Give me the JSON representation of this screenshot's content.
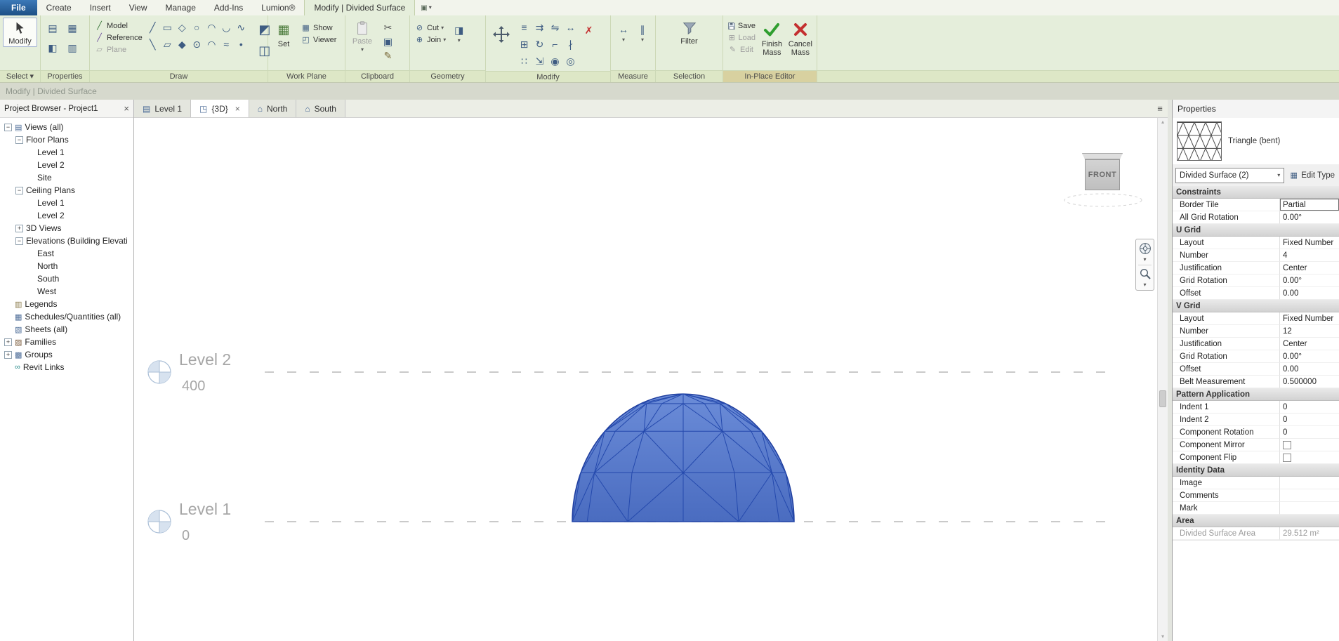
{
  "ribbon": {
    "tabs": [
      {
        "label": "File",
        "type": "file"
      },
      {
        "label": "Create"
      },
      {
        "label": "Insert"
      },
      {
        "label": "View"
      },
      {
        "label": "Manage"
      },
      {
        "label": "Add-Ins"
      },
      {
        "label": "Lumion®"
      },
      {
        "label": "Modify | Divided Surface",
        "active": true
      }
    ],
    "select": {
      "modify_label": "Modify",
      "panel_label": "Select ▾"
    },
    "properties_panel": {
      "panel_label": "Properties",
      "tools": [
        {
          "name": "properties-palette-icon",
          "glyph": "▤"
        },
        {
          "name": "family-types-icon",
          "glyph": "▦"
        },
        {
          "name": "family-category-icon",
          "glyph": "◧"
        },
        {
          "name": "visibility-icon",
          "glyph": "▥"
        }
      ]
    },
    "draw": {
      "panel_label": "Draw",
      "model_label": "Model",
      "reference_label": "Reference",
      "plane_label": "Plane",
      "model_icon": "╱",
      "reference_icon": "╱",
      "plane_icon": "▱",
      "tools": [
        {
          "name": "line-icon",
          "glyph": "╱"
        },
        {
          "name": "rectangle-icon",
          "glyph": "▭"
        },
        {
          "name": "polygon-icon",
          "glyph": "◇"
        },
        {
          "name": "circle-icon",
          "glyph": "○"
        },
        {
          "name": "start-end-arc-icon",
          "glyph": "◠"
        },
        {
          "name": "center-arc-icon",
          "glyph": "◡"
        },
        {
          "name": "spline-icon",
          "glyph": "∿"
        },
        {
          "name": "pick-lines-icon",
          "glyph": "╲"
        },
        {
          "name": "rotated-rectangle-icon",
          "glyph": "▱"
        },
        {
          "name": "inscribed-polygon-icon",
          "glyph": "◆"
        },
        {
          "name": "ellipse-icon",
          "glyph": "⊙"
        },
        {
          "name": "fillet-arc-icon",
          "glyph": "◠"
        },
        {
          "name": "tangent-arc-icon",
          "glyph": "≈"
        },
        {
          "name": "point-element-icon",
          "glyph": "•"
        }
      ],
      "extra_tools": [
        {
          "name": "set-surface-icon",
          "glyph": "◩"
        },
        {
          "name": "divide-surface-icon",
          "glyph": "◫"
        }
      ]
    },
    "work_plane": {
      "panel_label": "Work Plane",
      "set_label": "Set",
      "show_label": "Show",
      "viewer_label": "Viewer",
      "set_icon": "▦",
      "show_icon": "▦",
      "viewer_icon": "◰"
    },
    "clipboard": {
      "panel_label": "Clipboard",
      "paste_label": "Paste",
      "tools": [
        {
          "name": "cut-icon",
          "glyph": "✂"
        },
        {
          "name": "copy-icon",
          "glyph": "▣"
        },
        {
          "name": "match-type-icon",
          "glyph": "✎"
        }
      ]
    },
    "geometry": {
      "panel_label": "Geometry",
      "cut_label": "Cut",
      "join_label": "Join",
      "cut_icon": "⊘",
      "join_icon": "⊕",
      "paint_icon": "◨"
    },
    "modify": {
      "panel_label": "Modify",
      "tools": [
        {
          "name": "align-icon",
          "glyph": "≡"
        },
        {
          "name": "offset-icon",
          "glyph": "⇉"
        },
        {
          "name": "mirror-icon",
          "glyph": "⇋"
        },
        {
          "name": "move-small-icon",
          "glyph": "↔"
        },
        {
          "name": "copy-element-icon",
          "glyph": "⊞"
        },
        {
          "name": "rotate-icon",
          "glyph": "↻"
        },
        {
          "name": "trim-icon",
          "glyph": "⌐"
        },
        {
          "name": "split-icon",
          "glyph": "∤"
        },
        {
          "name": "array-icon",
          "glyph": "∷"
        },
        {
          "name": "scale-icon",
          "glyph": "⇲"
        },
        {
          "name": "pin-icon",
          "glyph": "◉"
        },
        {
          "name": "unpin-icon",
          "glyph": "◎"
        }
      ],
      "delete_icon": "✗"
    },
    "measure": {
      "panel_label": "Measure",
      "tools": [
        {
          "name": "measure-icon",
          "glyph": "↔"
        },
        {
          "name": "dimension-icon",
          "glyph": "∥"
        }
      ]
    },
    "selection": {
      "panel_label": "Selection",
      "filter_label": "Filter"
    },
    "in_place": {
      "panel_label": "In-Place Editor",
      "save_label": "Save",
      "load_label": "Load",
      "edit_label": "Edit",
      "finish_label": "Finish Mass",
      "cancel_label": "Cancel Mass"
    }
  },
  "status_bar": {
    "text": "Modify | Divided Surface"
  },
  "project_browser": {
    "title": "Project Browser - Project1",
    "tree": [
      {
        "label": "Views (all)",
        "depth": 0,
        "toggle": "minus",
        "icon": {
          "name": "views-icon",
          "glyph": "▤",
          "color": "#4a6a96"
        }
      },
      {
        "label": "Floor Plans",
        "depth": 1,
        "toggle": "minus"
      },
      {
        "label": "Level 1",
        "depth": 2
      },
      {
        "label": "Level 2",
        "depth": 2
      },
      {
        "label": "Site",
        "depth": 2
      },
      {
        "label": "Ceiling Plans",
        "depth": 1,
        "toggle": "minus"
      },
      {
        "label": "Level 1",
        "depth": 2
      },
      {
        "label": "Level 2",
        "depth": 2
      },
      {
        "label": "3D Views",
        "depth": 1,
        "toggle": "plus"
      },
      {
        "label": "Elevations (Building Elevati",
        "depth": 1,
        "toggle": "minus"
      },
      {
        "label": "East",
        "depth": 2
      },
      {
        "label": "North",
        "depth": 2
      },
      {
        "label": "South",
        "depth": 2
      },
      {
        "label": "West",
        "depth": 2
      },
      {
        "label": "Legends",
        "depth": 0,
        "icon": {
          "name": "legends-icon",
          "glyph": "▥",
          "color": "#8a7a4a"
        }
      },
      {
        "label": "Schedules/Quantities (all)",
        "depth": 0,
        "icon": {
          "name": "schedules-icon",
          "glyph": "▦",
          "color": "#4a6a96"
        }
      },
      {
        "label": "Sheets (all)",
        "depth": 0,
        "icon": {
          "name": "sheets-icon",
          "glyph": "▧",
          "color": "#4a6a96"
        }
      },
      {
        "label": "Families",
        "depth": 0,
        "toggle": "plus",
        "icon": {
          "name": "families-icon",
          "glyph": "▨",
          "color": "#7a5a3a"
        }
      },
      {
        "label": "Groups",
        "depth": 0,
        "toggle": "plus",
        "icon": {
          "name": "groups-icon",
          "glyph": "▩",
          "color": "#4a6a96"
        }
      },
      {
        "label": "Revit Links",
        "depth": 0,
        "icon": {
          "name": "revit-links-icon",
          "glyph": "∞",
          "color": "#2a8a8a"
        }
      }
    ]
  },
  "view_tabs": [
    {
      "label": "Level 1",
      "icon_name": "floor-plan-icon",
      "icon_glyph": "▤"
    },
    {
      "label": "{3D}",
      "icon_name": "3d-view-icon",
      "icon_glyph": "◳",
      "active": true,
      "closable": true
    },
    {
      "label": "North",
      "icon_name": "elevation-icon",
      "icon_glyph": "⌂"
    },
    {
      "label": "South",
      "icon_name": "elevation-icon",
      "icon_glyph": "⌂"
    }
  ],
  "canvas": {
    "levels": [
      {
        "name": "Level 2",
        "elevation": "400"
      },
      {
        "name": "Level 1",
        "elevation": "0"
      }
    ],
    "viewcube_label": "FRONT"
  },
  "properties": {
    "title": "Properties",
    "type_preview_label": "Triangle (bent)",
    "type_selector": "Divided Surface (2)",
    "edit_type_label": "Edit Type",
    "groups": [
      {
        "header": "Constraints",
        "rows": [
          {
            "name": "Border Tile",
            "value": "Partial",
            "selected": true
          },
          {
            "name": "All Grid Rotation",
            "value": "0.00°"
          }
        ]
      },
      {
        "header": "U Grid",
        "rows": [
          {
            "name": "Layout",
            "value": "Fixed Number"
          },
          {
            "name": "Number",
            "value": "4"
          },
          {
            "name": "Justification",
            "value": "Center"
          },
          {
            "name": "Grid Rotation",
            "value": "0.00°"
          },
          {
            "name": "Offset",
            "value": "0.00"
          }
        ]
      },
      {
        "header": "V Grid",
        "rows": [
          {
            "name": "Layout",
            "value": "Fixed Number"
          },
          {
            "name": "Number",
            "value": "12"
          },
          {
            "name": "Justification",
            "value": "Center"
          },
          {
            "name": "Grid Rotation",
            "value": "0.00°"
          },
          {
            "name": "Offset",
            "value": "0.00"
          },
          {
            "name": "Belt Measurement",
            "value": "0.500000"
          }
        ]
      },
      {
        "header": "Pattern Application",
        "rows": [
          {
            "name": "Indent 1",
            "value": "0"
          },
          {
            "name": "Indent 2",
            "value": "0"
          },
          {
            "name": "Component Rotation",
            "value": "0"
          },
          {
            "name": "Component Mirror",
            "checkbox": true
          },
          {
            "name": "Component Flip",
            "checkbox": true
          }
        ]
      },
      {
        "header": "Identity Data",
        "rows": [
          {
            "name": "Image",
            "value": ""
          },
          {
            "name": "Comments",
            "value": ""
          },
          {
            "name": "Mark",
            "value": ""
          }
        ]
      },
      {
        "header": "Area",
        "rows": [
          {
            "name": "Divided Surface Area",
            "value": "29.512 m²",
            "readonly": true
          }
        ]
      }
    ]
  },
  "colors": {
    "ribbon_bg": "#e5eedb",
    "contextual_panel": "#d8d1a0",
    "mass_fill": "#5578cc",
    "mass_edge": "#2449ad",
    "finish_green": "#2f9e2f",
    "cancel_red": "#c43030"
  }
}
